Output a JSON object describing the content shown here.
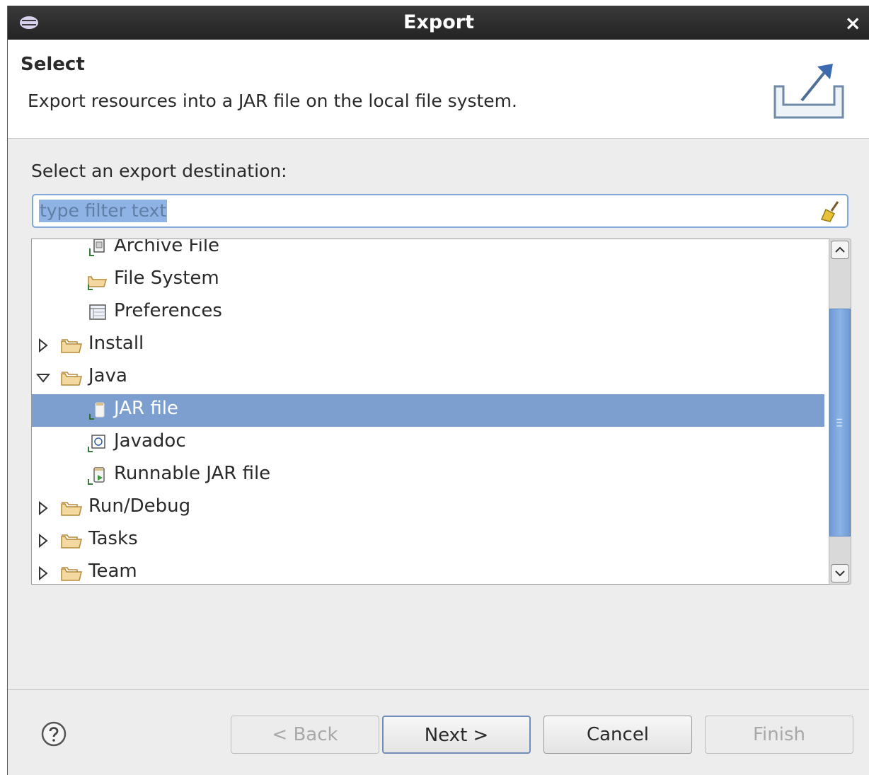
{
  "window": {
    "title": "Export"
  },
  "header": {
    "title": "Select",
    "description": "Export resources into a JAR file on the local file system."
  },
  "prompt": "Select an export destination:",
  "filter": {
    "placeholder": "type filter text"
  },
  "tree": {
    "items": [
      {
        "label": "Archive File",
        "level": 1,
        "expanded": null,
        "selected": false,
        "icon": "archive-file-icon"
      },
      {
        "label": "File System",
        "level": 1,
        "expanded": null,
        "selected": false,
        "icon": "file-system-icon"
      },
      {
        "label": "Preferences",
        "level": 1,
        "expanded": null,
        "selected": false,
        "icon": "preferences-icon"
      },
      {
        "label": "Install",
        "level": 0,
        "expanded": false,
        "selected": false,
        "icon": "folder-icon"
      },
      {
        "label": "Java",
        "level": 0,
        "expanded": true,
        "selected": false,
        "icon": "folder-icon"
      },
      {
        "label": "JAR file",
        "level": 1,
        "expanded": null,
        "selected": true,
        "icon": "jar-file-icon"
      },
      {
        "label": "Javadoc",
        "level": 1,
        "expanded": null,
        "selected": false,
        "icon": "javadoc-icon"
      },
      {
        "label": "Runnable JAR file",
        "level": 1,
        "expanded": null,
        "selected": false,
        "icon": "runnable-jar-icon"
      },
      {
        "label": "Run/Debug",
        "level": 0,
        "expanded": false,
        "selected": false,
        "icon": "folder-icon"
      },
      {
        "label": "Tasks",
        "level": 0,
        "expanded": false,
        "selected": false,
        "icon": "folder-icon"
      },
      {
        "label": "Team",
        "level": 0,
        "expanded": false,
        "selected": false,
        "icon": "folder-icon"
      }
    ]
  },
  "buttons": {
    "back": "< Back",
    "next": "Next >",
    "cancel": "Cancel",
    "finish": "Finish"
  },
  "colors": {
    "selection": "#7c9fcf",
    "titlebar": "#2d2d2d",
    "scroll_thumb": "#7ea6dc"
  }
}
